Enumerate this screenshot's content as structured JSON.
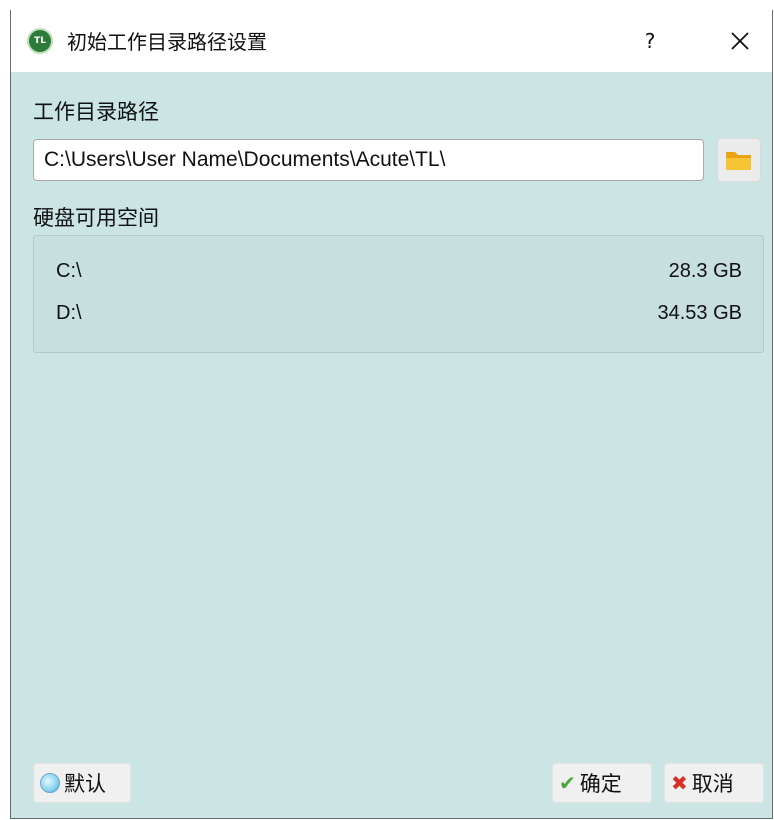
{
  "window": {
    "title": "初始工作目录路径设置",
    "help_label": "?"
  },
  "work_dir": {
    "label": "工作目录路径",
    "path_value": "C:\\Users\\User Name\\Documents\\Acute\\TL\\"
  },
  "disk": {
    "label": "硬盘可用空间",
    "drives": [
      {
        "drive": "C:\\",
        "free": "28.3 GB"
      },
      {
        "drive": "D:\\",
        "free": "34.53 GB"
      }
    ]
  },
  "footer": {
    "default_label": "默认",
    "ok_label": "确定",
    "cancel_label": "取消"
  },
  "icons": {
    "app": "tl-app-icon",
    "folder": "folder-icon",
    "close": "close-icon",
    "ok": "checkmark-icon",
    "cancel": "cross-icon",
    "default": "radio-icon"
  },
  "colors": {
    "dialog_bg": "#cbe5e5",
    "titlebar_bg": "#ffffff",
    "ok_accent": "#4aa73a",
    "cancel_accent": "#d93025"
  }
}
